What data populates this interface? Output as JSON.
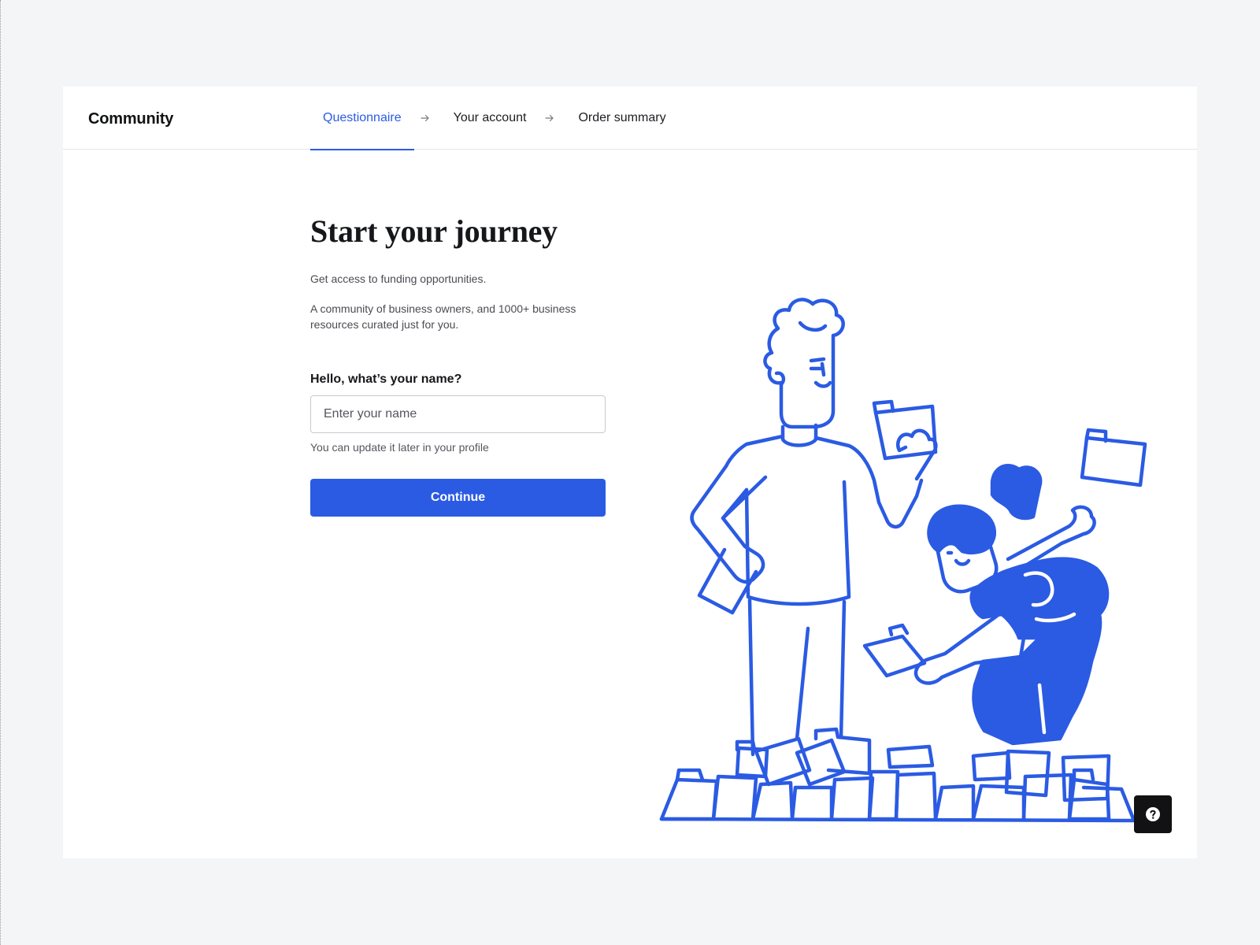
{
  "app": {
    "brand": "Community"
  },
  "stepper": {
    "steps": [
      {
        "label": "Questionnaire",
        "active": true
      },
      {
        "label": "Your account",
        "active": false
      },
      {
        "label": "Order summary",
        "active": false
      }
    ],
    "separator_icon": "arrow-right-icon"
  },
  "form": {
    "title": "Start your journey",
    "subtitle": "Get access to funding opportunities.",
    "description": "A community of business owners, and 1000+ business resources curated just for you.",
    "name_label": "Hello, what’s your name?",
    "name_value": "",
    "name_placeholder": "Enter your name",
    "name_hint": "You can update it later in your profile",
    "continue_label": "Continue"
  },
  "illustration": {
    "name": "people-sorting-folders-illustration",
    "stroke_color": "#2b5be3"
  },
  "help": {
    "icon": "question-mark-icon"
  },
  "colors": {
    "accent": "#2b5be3",
    "page_background": "#f4f5f7",
    "card_background": "#ffffff",
    "help_button": "#121214"
  }
}
